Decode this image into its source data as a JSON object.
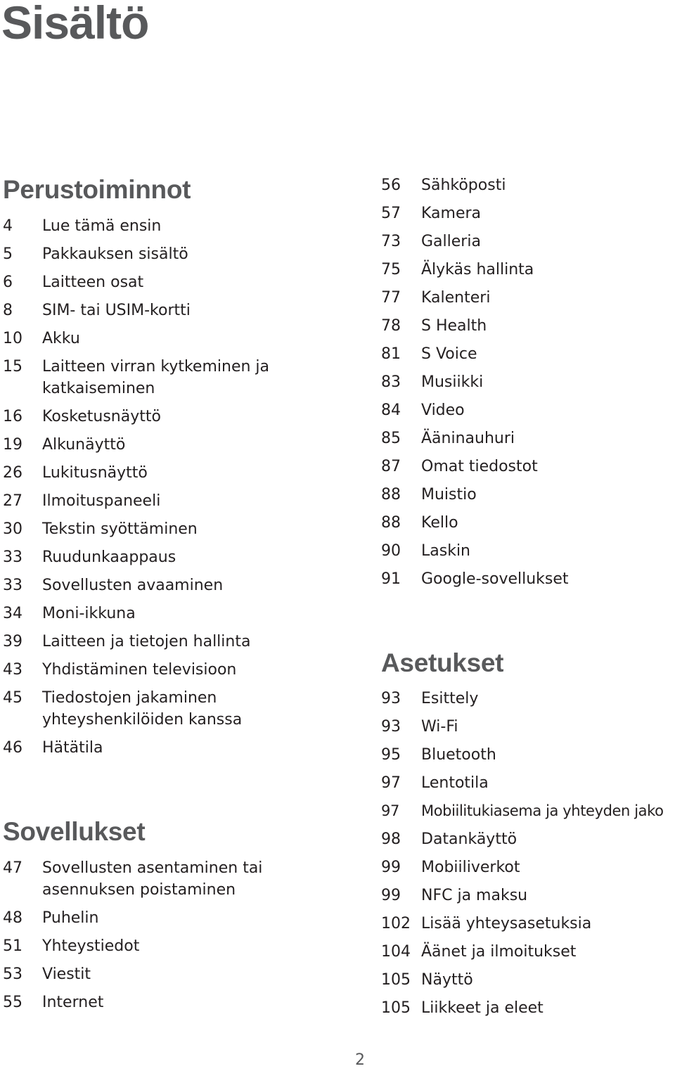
{
  "title": "Sisältö",
  "page_number": "2",
  "sections": {
    "perustoiminnot": {
      "heading": "Perustoiminnot",
      "entries": [
        {
          "page": "4",
          "label": "Lue tämä ensin"
        },
        {
          "page": "5",
          "label": "Pakkauksen sisältö"
        },
        {
          "page": "6",
          "label": "Laitteen osat"
        },
        {
          "page": "8",
          "label": "SIM- tai USIM-kortti"
        },
        {
          "page": "10",
          "label": "Akku"
        },
        {
          "page": "15",
          "label": "Laitteen virran kytkeminen ja katkaiseminen"
        },
        {
          "page": "16",
          "label": "Kosketusnäyttö"
        },
        {
          "page": "19",
          "label": "Alkunäyttö"
        },
        {
          "page": "26",
          "label": "Lukitusnäyttö"
        },
        {
          "page": "27",
          "label": "Ilmoituspaneeli"
        },
        {
          "page": "30",
          "label": "Tekstin syöttäminen"
        },
        {
          "page": "33",
          "label": "Ruudunkaappaus"
        },
        {
          "page": "33",
          "label": "Sovellusten avaaminen"
        },
        {
          "page": "34",
          "label": "Moni-ikkuna"
        },
        {
          "page": "39",
          "label": "Laitteen ja tietojen hallinta"
        },
        {
          "page": "43",
          "label": "Yhdistäminen televisioon"
        },
        {
          "page": "45",
          "label": "Tiedostojen jakaminen yhteyshenkilöiden kanssa"
        },
        {
          "page": "46",
          "label": "Hätätila"
        }
      ]
    },
    "sovellukset": {
      "heading": "Sovellukset",
      "entries": [
        {
          "page": "47",
          "label": "Sovellusten asentaminen tai asennuksen poistaminen"
        },
        {
          "page": "48",
          "label": "Puhelin"
        },
        {
          "page": "51",
          "label": "Yhteystiedot"
        },
        {
          "page": "53",
          "label": "Viestit"
        },
        {
          "page": "55",
          "label": "Internet"
        },
        {
          "page": "56",
          "label": "Sähköposti"
        },
        {
          "page": "57",
          "label": "Kamera"
        },
        {
          "page": "73",
          "label": "Galleria"
        },
        {
          "page": "75",
          "label": "Älykäs hallinta"
        },
        {
          "page": "77",
          "label": "Kalenteri"
        },
        {
          "page": "78",
          "label": "S Health"
        },
        {
          "page": "81",
          "label": "S Voice"
        },
        {
          "page": "83",
          "label": "Musiikki"
        },
        {
          "page": "84",
          "label": "Video"
        },
        {
          "page": "85",
          "label": "Ääninauhuri"
        },
        {
          "page": "87",
          "label": "Omat tiedostot"
        },
        {
          "page": "88",
          "label": "Muistio"
        },
        {
          "page": "88",
          "label": "Kello"
        },
        {
          "page": "90",
          "label": "Laskin"
        },
        {
          "page": "91",
          "label": "Google-sovellukset"
        }
      ]
    },
    "asetukset": {
      "heading": "Asetukset",
      "entries": [
        {
          "page": "93",
          "label": "Esittely"
        },
        {
          "page": "93",
          "label": "Wi-Fi"
        },
        {
          "page": "95",
          "label": "Bluetooth"
        },
        {
          "page": "97",
          "label": "Lentotila"
        },
        {
          "page": "97",
          "label": "Mobiilitukiasema ja yhteyden jako"
        },
        {
          "page": "98",
          "label": "Datankäyttö"
        },
        {
          "page": "99",
          "label": "Mobiiliverkot"
        },
        {
          "page": "99",
          "label": "NFC ja maksu"
        },
        {
          "page": "102",
          "label": "Lisää yhteysasetuksia"
        },
        {
          "page": "104",
          "label": "Äänet ja ilmoitukset"
        },
        {
          "page": "105",
          "label": "Näyttö"
        },
        {
          "page": "105",
          "label": "Liikkeet ja eleet"
        }
      ]
    }
  }
}
